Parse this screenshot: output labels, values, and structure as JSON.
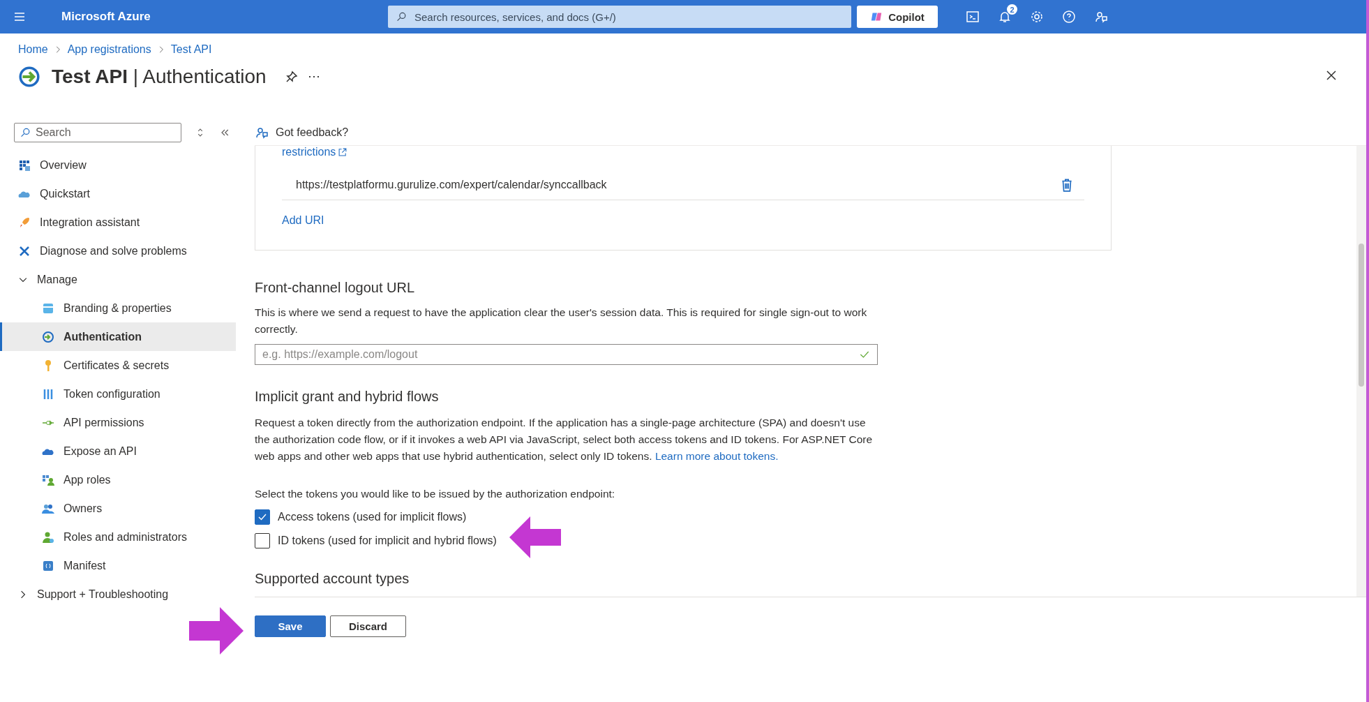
{
  "top_bar": {
    "brand": "Microsoft Azure",
    "search": {
      "placeholder": "Search resources, services, and docs (G+/)"
    },
    "copilot": "Copilot",
    "notification_count": "2"
  },
  "breadcrumb": [
    "Home",
    "App registrations",
    "Test API"
  ],
  "page_title": "**Test API** | Authentication",
  "sidebar": {
    "search": {
      "placeholder": "Search"
    },
    "items": [
      {
        "label": "Overview",
        "selected": false
      },
      {
        "label": "Quickstart",
        "selected": false
      },
      {
        "label": "Integration assistant",
        "selected": false
      },
      {
        "label": "Diagnose and solve problems",
        "selected": false
      },
      {
        "label": "Manage",
        "kind": "group",
        "expanded": true,
        "children": [
          {
            "label": "Branding & properties",
            "selected": false
          },
          {
            "label": "Authentication",
            "selected": true
          },
          {
            "label": "Certificates & secrets",
            "selected": false
          },
          {
            "label": "Token configuration",
            "selected": false
          },
          {
            "label": "API permissions",
            "selected": false
          },
          {
            "label": "Expose an API",
            "selected": false
          },
          {
            "label": "App roles",
            "selected": false
          },
          {
            "label": "Owners",
            "selected": false
          },
          {
            "label": "Roles and administrators",
            "selected": false
          },
          {
            "label": "Manifest",
            "selected": false
          }
        ]
      },
      {
        "label": "Support + Troubleshooting",
        "kind": "group",
        "expanded": false
      }
    ]
  },
  "command_bar": {
    "feedback": "Got feedback?"
  },
  "redirect_card": {
    "restrictions_link": "restrictions",
    "uris": [
      "https://testplatformu.gurulize.com/expert/calendar/synccallback"
    ],
    "add_uri": "Add URI"
  },
  "front_channel": {
    "heading": "Front-channel logout URL",
    "description": "This is where we send a request to have the application clear the user's session data. This is required for single sign-out to work correctly.",
    "input": {
      "placeholder": "e.g. https://example.com/logout"
    }
  },
  "implicit_grant": {
    "heading": "Implicit grant and hybrid flows",
    "description": "Request a token directly from the authorization endpoint. If the application has a single-page architecture (SPA) and doesn't use the authorization code flow, or if it invokes a web API via JavaScript, select both access tokens and ID tokens. For ASP.NET Core web apps and other web apps that use hybrid authentication, select only ID tokens.",
    "learn_more": "Learn more about tokens.",
    "prompt": "Select the tokens you would like to be issued by the authorization endpoint:",
    "tokens": [
      {
        "label": "Access tokens (used for implicit flows)",
        "checked": true
      },
      {
        "label": "ID tokens (used for implicit and hybrid flows)",
        "checked": false
      }
    ]
  },
  "next_section": {
    "heading": "Supported account types"
  },
  "footer_buttons": [
    {
      "label": "Save",
      "kind": "primary"
    },
    {
      "label": "Discard",
      "kind": "secondary"
    }
  ]
}
